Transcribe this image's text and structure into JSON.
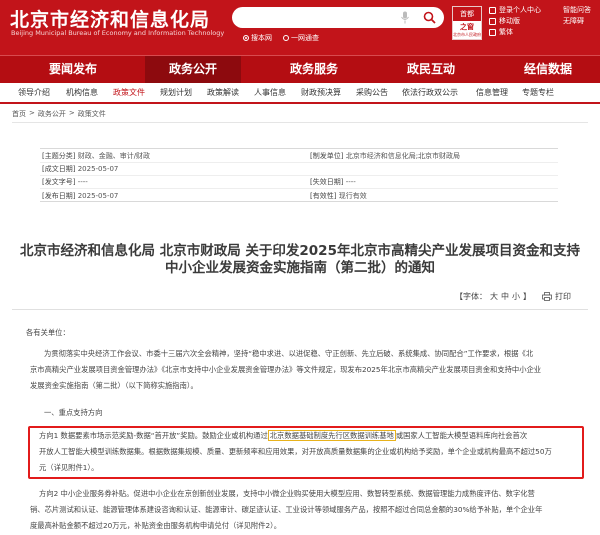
{
  "header": {
    "logo_cn": "北京市经济和信息化局",
    "logo_en": "Beijing Municipal Bureau of Economy and Information Technology",
    "search_scopes": [
      "搜本网",
      "一网通查"
    ],
    "seal": {
      "top": "首都",
      "mid": "之窗",
      "bottom": "北京市人民政府"
    },
    "links": [
      "登录个人中心",
      "智能问答",
      "无障碍",
      "移动版",
      "繁体"
    ]
  },
  "nav": {
    "main": [
      "要闻发布",
      "政务公开",
      "政务服务",
      "政民互动",
      "经信数据"
    ],
    "active_main": 1,
    "sub": [
      "领导介绍",
      "机构信息",
      "政策文件",
      "规划计划",
      "政策解读",
      "人事信息",
      "财政预决算",
      "采购公告",
      "依法行政双公示",
      "信息管理",
      "专题专栏"
    ],
    "active_sub": 2
  },
  "breadcrumb": [
    "首页",
    ">",
    "政务公开",
    ">",
    "政策文件"
  ],
  "meta": {
    "subject_label": "[主题分类]",
    "subject": "财政、金融、审计/财政",
    "issuer_label": "[制发单位]",
    "issuer": "北京市经济和信息化局;北京市财政局",
    "date_label": "[成文日期]",
    "date": "2025-05-07",
    "ref_label": "[发文字号]",
    "ref": "----",
    "expire_label": "[失效日期]",
    "expire": "----",
    "pub_label": "[发布日期]",
    "pub": "2025-05-07",
    "valid_label": "[有效性]",
    "valid": "现行有效"
  },
  "title": {
    "line1": "北京市经济和信息化局 北京市财政局 关于印发2025年北京市高精尖产业发展项目资金和支持",
    "line2": "中小企业发展资金实施指南（第二批）的通知"
  },
  "toolbar": {
    "font_label": "【字体：",
    "large": "大",
    "medium": "中",
    "small": "小",
    "close": "】",
    "print": "打印"
  },
  "body": {
    "greeting": "各有关单位：",
    "intro": [
      "为贯彻落实中央经济工作会议、市委十三届六次全会精神，坚持“稳中求进、以进促稳、守正创新、先立后破、系统集成、协同配合”工作要求，根据《北",
      "京市高精尖产业发展项目资金管理办法》《北京市支持中小企业发展资金管理办法》等文件规定，现发布2025年北京市高精尖产业发展项目资金和支持中小企业",
      "发展资金实施指南（第二批）（以下简称实施指南）。"
    ],
    "section1": "一、重点支持方向",
    "dir1": {
      "pre": "方向1 数据要素市场示范奖励-数据“首开放”奖励。鼓励企业或机构通过",
      "mark": "北京数据基础制度先行区数据训练基地",
      "post": "或国家人工智能大模型语料库向社会首次",
      "line2": "开放人工智能大模型训练数据集。根据数据集规模、质量、更新频率和应用效果，对开放高质量数据集的企业或机构给予奖励，单个企业或机构最高不超过50万",
      "line3": "元（详见附件1）。"
    },
    "dir2": [
      "方向2 中小企业服务券补贴。促进中小企业在京创新创业发展，支持中小微企业购买使用大模型应用、数智转型系统、数据管理能力成熟度评估、数字化营",
      "销、芯片测试和认证、能源管理体系建设咨询和认证、能源审计、碳足迹认证、工业设计等领域服务产品，按照不超过合同总金额的30%给予补贴，单个企业年",
      "度最高补贴金额不超过20万元，补贴资金由服务机构申请兑付（详见附件2）。"
    ]
  }
}
